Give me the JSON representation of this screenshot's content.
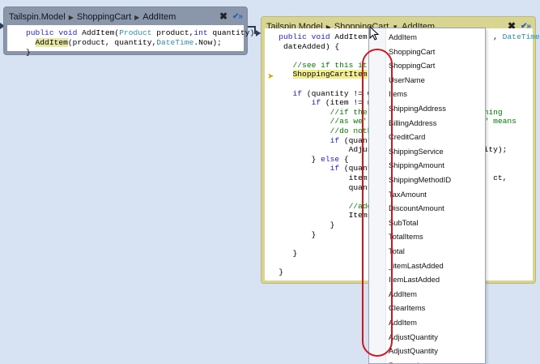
{
  "bubble1": {
    "breadcrumb": [
      "Tailspin.Model",
      "ShoppingCart",
      "AddItem"
    ],
    "close_icon": "close-icon",
    "pin_icon": "pin-icon",
    "code": [
      [
        {
          "t": "    "
        },
        {
          "t": "public",
          "c": "kw"
        },
        {
          "t": " "
        },
        {
          "t": "void",
          "c": "kw"
        },
        {
          "t": " AddItem("
        },
        {
          "t": "Product",
          "c": "ty"
        },
        {
          "t": " product,"
        },
        {
          "t": "int",
          "c": "kw"
        },
        {
          "t": " quantity) {"
        }
      ],
      [
        {
          "t": "      "
        },
        {
          "t": "AddItem",
          "c": "hl2"
        },
        {
          "t": "(product, quantity,"
        },
        {
          "t": "DateTime",
          "c": "ty"
        },
        {
          "t": ".Now);"
        }
      ],
      [
        {
          "t": "    }"
        }
      ]
    ]
  },
  "bubble2": {
    "breadcrumb": [
      "Tailspin.Model",
      "ShoppingCart",
      "AddItem"
    ],
    "close_icon": "close-icon",
    "pin_icon": "pin-icon",
    "code": [
      [
        {
          "t": "   "
        },
        {
          "t": "public",
          "c": "kw"
        },
        {
          "t": " "
        },
        {
          "t": "void",
          "c": "kw"
        },
        {
          "t": " AddItem("
        },
        {
          "t": "P",
          "c": "ty"
        },
        {
          "t": "                         "
        },
        {
          "t": ", ",
          "c": ""
        },
        {
          "t": "DateTime",
          "c": "ty"
        }
      ],
      [
        {
          "t": "    dateAdded) {"
        }
      ],
      [
        {
          "t": ""
        }
      ],
      [
        {
          "t": "      "
        },
        {
          "t": "//see if this it",
          "c": "cm"
        }
      ],
      [
        {
          "t": "      "
        },
        {
          "t": "ShoppingCartItem",
          "c": "hl"
        }
      ],
      [
        {
          "t": ""
        }
      ],
      [
        {
          "t": "      "
        },
        {
          "t": "if",
          "c": "kw"
        },
        {
          "t": " (quantity != 0"
        }
      ],
      [
        {
          "t": "          "
        },
        {
          "t": "if",
          "c": "kw"
        },
        {
          "t": " (item != n"
        }
      ],
      [
        {
          "t": "              "
        },
        {
          "t": "//if the",
          "c": "cm"
        },
        {
          "t": "                        "
        },
        {
          "t": "thing",
          "c": "cm"
        }
      ],
      [
        {
          "t": "              "
        },
        {
          "t": "//as we'r",
          "c": "cm"
        },
        {
          "t": "                      "
        },
        {
          "t": "em\" means",
          "c": "cm"
        }
      ],
      [
        {
          "t": "              "
        },
        {
          "t": "//do noth",
          "c": "cm"
        }
      ],
      [
        {
          "t": "              "
        },
        {
          "t": "if",
          "c": "kw"
        },
        {
          "t": " (quant"
        }
      ],
      [
        {
          "t": "                  Adjus"
        },
        {
          "t": "                       tity);"
        }
      ],
      [
        {
          "t": "          } "
        },
        {
          "t": "else",
          "c": "kw"
        },
        {
          "t": " {"
        }
      ],
      [
        {
          "t": "              "
        },
        {
          "t": "if",
          "c": "kw"
        },
        {
          "t": " (quant"
        }
      ],
      [
        {
          "t": "                  item"
        },
        {
          "t": "                           ct,"
        }
      ],
      [
        {
          "t": "                  quanti"
        }
      ],
      [
        {
          "t": ""
        }
      ],
      [
        {
          "t": "                  "
        },
        {
          "t": "//add",
          "c": "cm"
        }
      ],
      [
        {
          "t": "                  Items"
        }
      ],
      [
        {
          "t": "              }"
        }
      ],
      [
        {
          "t": "          }"
        }
      ],
      [
        {
          "t": ""
        }
      ],
      [
        {
          "t": "      }"
        }
      ],
      [
        {
          "t": ""
        }
      ],
      [
        {
          "t": "   }"
        }
      ]
    ]
  },
  "dropdown": {
    "items": [
      "AddItem",
      "ShoppingCart",
      "ShoppingCart",
      "UserName",
      "Items",
      "ShippingAddress",
      "BillingAddress",
      "CreditCard",
      "ShippingService",
      "ShippingAmount",
      "ShippingMethodID",
      "TaxAmount",
      "DiscountAmount",
      "SubTotal",
      "TotalItems",
      "Total",
      "_itemLastAdded",
      "ItemLastAdded",
      "AddItem",
      "ClearItems",
      "AddItem",
      "AdjustQuantity",
      "AdjustQuantity",
      "RemoveItem"
    ]
  },
  "colors": {
    "bubble1_bg": "#8a97aa",
    "bubble2_bg": "#d8d492",
    "annotation": "#d2181c",
    "keyword": "#1f1fd6",
    "type": "#2b91af",
    "comment": "#008000"
  }
}
